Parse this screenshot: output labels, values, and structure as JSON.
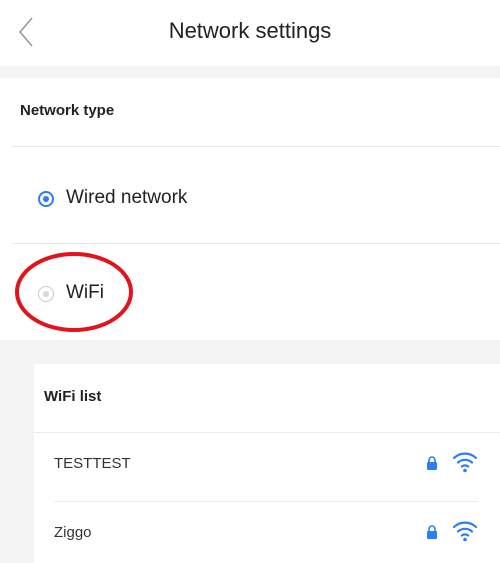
{
  "header": {
    "title": "Network settings",
    "back_icon": "chevron-left-icon"
  },
  "network_type": {
    "label": "Network type",
    "options": [
      {
        "label": "Wired network",
        "selected": true
      },
      {
        "label": "WiFi",
        "selected": false
      }
    ]
  },
  "wifi_list": {
    "label": "WiFi list",
    "networks": [
      {
        "name": "TESTTEST",
        "secured": true,
        "icons": [
          "lock-icon",
          "wifi-signal-icon"
        ]
      },
      {
        "name": "Ziggo",
        "secured": true,
        "icons": [
          "lock-icon",
          "wifi-signal-icon"
        ]
      }
    ]
  },
  "colors": {
    "accent": "#2e7cf6",
    "highlight_annotation": "#e3131b",
    "section_background": "#f3f3f3",
    "divider": "#e9e9e9"
  }
}
